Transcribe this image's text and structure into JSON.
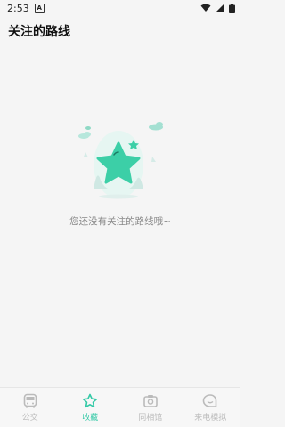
{
  "status": {
    "time": "2:53",
    "badge": "A"
  },
  "header": {
    "title": "关注的路线"
  },
  "empty": {
    "message": "您还没有关注的路线哦~"
  },
  "nav": {
    "items": [
      {
        "label": "公交",
        "icon": "bus-icon"
      },
      {
        "label": "收藏",
        "icon": "star-icon",
        "active": true
      },
      {
        "label": "同相馆",
        "icon": "camera-icon"
      },
      {
        "label": "来电模拟",
        "icon": "chat-icon"
      }
    ]
  },
  "colors": {
    "accent": "#33c9a6",
    "inactive": "#bbbbbb"
  }
}
